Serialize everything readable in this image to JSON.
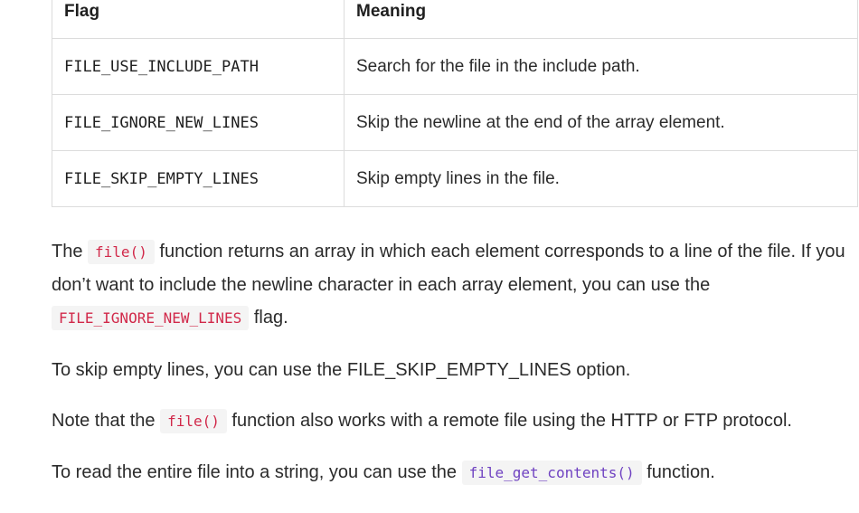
{
  "table": {
    "headers": [
      "Flag",
      "Meaning"
    ],
    "rows": [
      {
        "flag": "FILE_USE_INCLUDE_PATH",
        "meaning": "Search for the file in the include path."
      },
      {
        "flag": "FILE_IGNORE_NEW_LINES",
        "meaning": "Skip the newline at the end of the array element."
      },
      {
        "flag": "FILE_SKIP_EMPTY_LINES",
        "meaning": "Skip empty lines in the file."
      }
    ]
  },
  "paragraphs": {
    "p1": {
      "t1": "The ",
      "code1": "file()",
      "t2": " function returns an array in which each element corresponds to a line of the file. If you don’t want to include the newline character in each array element, you can use the ",
      "code2": "FILE_IGNORE_NEW_LINES",
      "t3": " flag."
    },
    "p2": {
      "text": "To skip empty lines, you can use the FILE_SKIP_EMPTY_LINES option."
    },
    "p3": {
      "t1": "Note that the ",
      "code1": "file()",
      "t2": " function also works with a remote file using the HTTP or FTP protocol."
    },
    "p4": {
      "t1": "To read the entire file into a string, you can use the ",
      "code1": "file_get_contents()",
      "t2": " function."
    }
  },
  "colors": {
    "code_red": "#d1294a",
    "code_purple": "#6f42c1",
    "code_background": "#f4f4f4",
    "table_border": "#dcdcdc"
  }
}
